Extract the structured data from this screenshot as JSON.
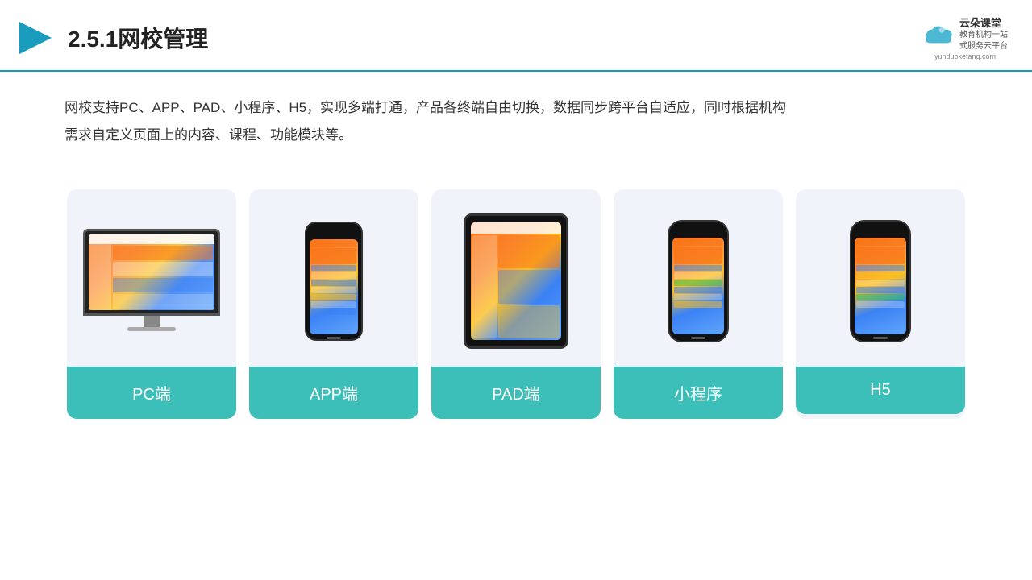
{
  "header": {
    "title": "2.5.1网校管理",
    "logo": {
      "name": "云朵课堂",
      "url": "yunduoketang.com",
      "tagline": "教育机构一站\n式服务云平台"
    }
  },
  "description": {
    "text": "网校支持PC、APP、PAD、小程序、H5，实现多端打通，产品各终端自由切换，数据同步跨平台自适应，同时根据机构需求自定义页面上的内容、课程、功能模块等。"
  },
  "cards": [
    {
      "id": "pc",
      "label": "PC端"
    },
    {
      "id": "app",
      "label": "APP端"
    },
    {
      "id": "pad",
      "label": "PAD端"
    },
    {
      "id": "miniprogram",
      "label": "小程序"
    },
    {
      "id": "h5",
      "label": "H5"
    }
  ]
}
